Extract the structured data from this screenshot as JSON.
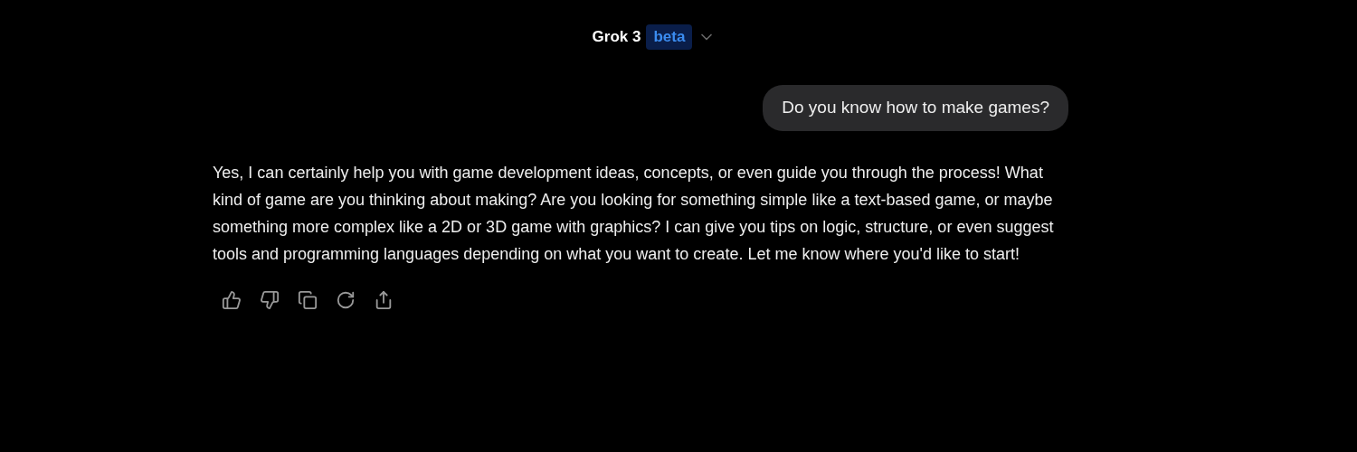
{
  "header": {
    "model": "Grok 3",
    "badge": "beta"
  },
  "messages": [
    {
      "kind": "user",
      "text": "Do you know how to make games?"
    },
    {
      "kind": "assistant",
      "text": "Yes, I can certainly help you with game development ideas, concepts, or even guide you through the process! What kind of game are you thinking about making? Are you looking for something simple like a text-based game, or maybe something more complex like a 2D or 3D game with graphics? I can give you tips on logic, structure, or even suggest tools and programming languages depending on what you want to create. Let me know where you'd like to start!"
    }
  ]
}
